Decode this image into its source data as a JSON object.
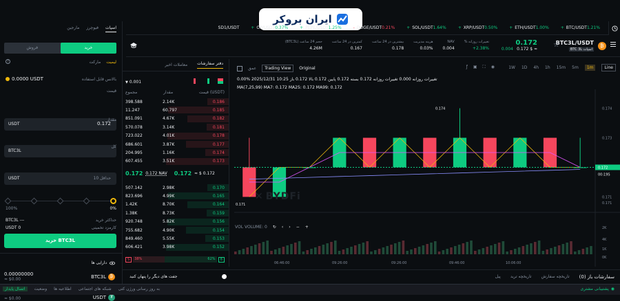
{
  "logo": {
    "text": "ایران بروکر"
  },
  "ticker": [
    {
      "sym": "BTC/USDT",
      "chg": "1.21%+",
      "dir": "up"
    },
    {
      "sym": "ETH/USDT",
      "chg": "1.00%+",
      "dir": "up"
    },
    {
      "sym": "XRP/USDT",
      "chg": "0.50%+",
      "dir": "up"
    },
    {
      "sym": "SOL/USDT",
      "chg": "1.64%+",
      "dir": "up"
    },
    {
      "sym": "DOGE/USDT",
      "chg": "0.21%-",
      "dir": "down"
    },
    {
      "sym": "PEPE/USDT",
      "chg": "1.25%+",
      "dir": "up"
    },
    {
      "sym": "OP/USDT",
      "chg": "0.37%+",
      "dir": "up"
    },
    {
      "sym": "SD1/USDT",
      "chg": "",
      "dir": "up"
    }
  ],
  "pair": {
    "name": "BTC3L/USDT",
    "badge": "BTC 3L اسپات",
    "price": "0.172",
    "price_usd": "0.172 $ ≈",
    "stats": [
      {
        "label": "تغییرات روزانه %",
        "value": "2.38%+",
        "cls": "grn"
      },
      {
        "label": "NAV",
        "value": "0.004",
        "cls": "wht"
      },
      {
        "label": "هزینه مدیریت",
        "value": "0.03%",
        "cls": "wht"
      },
      {
        "label": "بیشترین در 24 ساعت",
        "value": "0.178",
        "cls": "wht"
      },
      {
        "label": "کمترین در 24 ساعت",
        "value": "0.167",
        "cls": "wht"
      },
      {
        "label": "حجم 24 ساعت (BTC3L)",
        "value": "4.26M",
        "cls": "wht"
      }
    ],
    "change_small": "0.004"
  },
  "left": {
    "tabs": [
      "فیوچرز",
      "مارجین"
    ],
    "tab_active": "اسپات",
    "buy": "خرید",
    "sell": "فروش",
    "order_types": [
      "لیمیت",
      "مارکت"
    ],
    "available_label": "بالانس قابل استفاده",
    "available": "0.0000 USDT",
    "price_label": "قیمت",
    "price_val": "0.172",
    "price_unit": "USDT",
    "amount_label": "مقدار",
    "amount_unit": "BTC3L",
    "total_label": "کل",
    "total_unit": "USDT",
    "total_ph": "حداقل 10",
    "pct_left": "0%",
    "pct_right": "100%",
    "maxbuy_label": "حداکثر خرید",
    "maxbuy": "BTC3L ---",
    "fee_label": "کارمزد تخمینی",
    "fee": "USDT 0",
    "buy_btn": "خرید BTC3L",
    "assets_title": "دارایی ها",
    "asset1_name": "BTC3L",
    "asset1_amt": "0.00000000",
    "asset1_usd": "≈ $0.00",
    "asset2_name": "USDT",
    "asset2_amt": "0.0000",
    "asset2_usd": "≈ $0.00"
  },
  "book": {
    "tabs": [
      "دفتر سفارشات",
      "معاملات اخیر"
    ],
    "precision": "0.001",
    "headers": [
      "قیمت (USDT)",
      "مقدار",
      "مجموع"
    ],
    "asks": [
      [
        "0.186",
        "2.14K",
        "398.588"
      ],
      [
        "0.185",
        "60.797",
        "11.247"
      ],
      [
        "0.182",
        "4.67K",
        "851.091"
      ],
      [
        "0.181",
        "3.14K",
        "570.078"
      ],
      [
        "0.178",
        "4.01K",
        "723.022"
      ],
      [
        "0.177",
        "3.87K",
        "686.601"
      ],
      [
        "0.174",
        "1.16K",
        "204.995"
      ],
      [
        "0.173",
        "3.51K",
        "607.455"
      ]
    ],
    "mid_price": "0.172",
    "mid_nav": "0.172 NAV",
    "mid_usd": "≈ $ 0.172",
    "bids": [
      [
        "0.170",
        "2.98K",
        "507.142"
      ],
      [
        "0.165",
        "4.99K",
        "823.696"
      ],
      [
        "0.164",
        "8.70K",
        "1.42K"
      ],
      [
        "0.159",
        "8.73K",
        "1.38K"
      ],
      [
        "0.156",
        "5.82K",
        "920.748"
      ],
      [
        "0.154",
        "4.90K",
        "755.682"
      ],
      [
        "0.153",
        "5.55K",
        "849.460"
      ],
      [
        "0.152",
        "3.98K",
        "606.421"
      ]
    ],
    "buy_pct": "62%",
    "sell_pct": "38%",
    "buy_pct_v": 0.62,
    "buy_ratio_b": "B",
    "sell_ratio_s": "S"
  },
  "chart": {
    "intervals": [
      "Line",
      "1m",
      "5m",
      "15m",
      "1h",
      "4h",
      "1D",
      "1W"
    ],
    "active_interval": "1m",
    "mode_tabs": [
      "Original",
      "Trading View",
      "عمق"
    ],
    "info": "0.00% تغییرات روزانه 0.000 تغییرات روزانه 0.172 بسته 0.172 پایین 0.172 بالا 0.172 باز 10:25 2025/12/31",
    "ma_line": "MA(7,25,99)  MA7: 0.172  MA25: 0.172  MA99: 0.172",
    "vol_label": "VOL  VOLUME: 0",
    "watermark": "BYDFi",
    "y_labels": [
      "0.174",
      "0.173",
      "0.172",
      "0.171",
      "0.171"
    ],
    "current_price": "0.172",
    "countdown": "00:19S",
    "vol_labels": [
      "2K",
      "4K",
      "1K",
      "0K"
    ],
    "x_labels": [
      "06:46:00",
      "09:26:00",
      "09:26:00",
      "09:46:00",
      "10:06:00"
    ],
    "high_marker": "0.174",
    "low_marker": "0.171"
  },
  "chart_data": {
    "type": "candlestick",
    "candles": [
      [
        0.172,
        0.173,
        0.171,
        0.171
      ],
      [
        0.171,
        0.172,
        0.171,
        0.172
      ],
      [
        0.172,
        0.172,
        0.172,
        0.172
      ],
      [
        0.172,
        0.173,
        0.172,
        0.173
      ],
      [
        0.173,
        0.173,
        0.172,
        0.172
      ],
      [
        0.172,
        0.173,
        0.172,
        0.173
      ],
      [
        0.173,
        0.173,
        0.172,
        0.172
      ],
      [
        0.172,
        0.174,
        0.172,
        0.173
      ],
      [
        0.173,
        0.173,
        0.172,
        0.172
      ],
      [
        0.172,
        0.173,
        0.172,
        0.173
      ],
      [
        0.173,
        0.173,
        0.172,
        0.172
      ],
      [
        0.172,
        0.173,
        0.172,
        0.172
      ]
    ]
  },
  "bottom": {
    "tabs": [
      "سفارشات باز (0)",
      "تاریخچه سفارش",
      "تاریخچه ترید",
      "پیل"
    ],
    "hide_label": "جفت های دیگر را پنهان کنید"
  },
  "footer": {
    "items": [
      "اتصال پایدار",
      "وضعیت",
      "اطلاعیه ها",
      "شبکه های اجتماعی",
      "به روز رسانی ورژن کتی"
    ],
    "support": "پشتیبانی مشتری"
  }
}
